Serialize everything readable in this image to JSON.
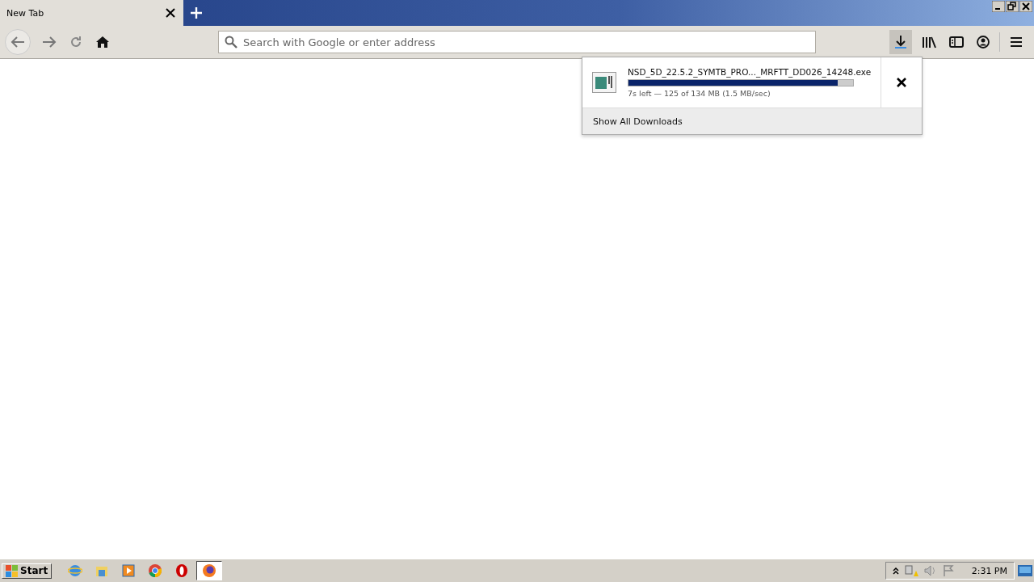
{
  "tabs": [
    {
      "label": "New Tab",
      "selected": true
    }
  ],
  "address_bar": {
    "placeholder": "Search with Google or enter address"
  },
  "downloads_panel": {
    "file_name": "NSD_5D_22.5.2_SYMTB_PRO..._MRFTT_DD026_14248.exe",
    "level": 0.93,
    "status": "7s left — 125 of 134 MB (1.5 MB/sec)",
    "footer": "Show All Downloads"
  },
  "taskbar": {
    "start": "Start",
    "apps": [
      {
        "kind": "ie",
        "selected": false
      },
      {
        "kind": "explorer",
        "selected": false
      },
      {
        "kind": "media",
        "selected": false
      },
      {
        "kind": "chrome",
        "selected": false
      },
      {
        "kind": "opera",
        "selected": false
      },
      {
        "kind": "firefox",
        "selected": true
      }
    ],
    "clock": "2:31 PM"
  }
}
